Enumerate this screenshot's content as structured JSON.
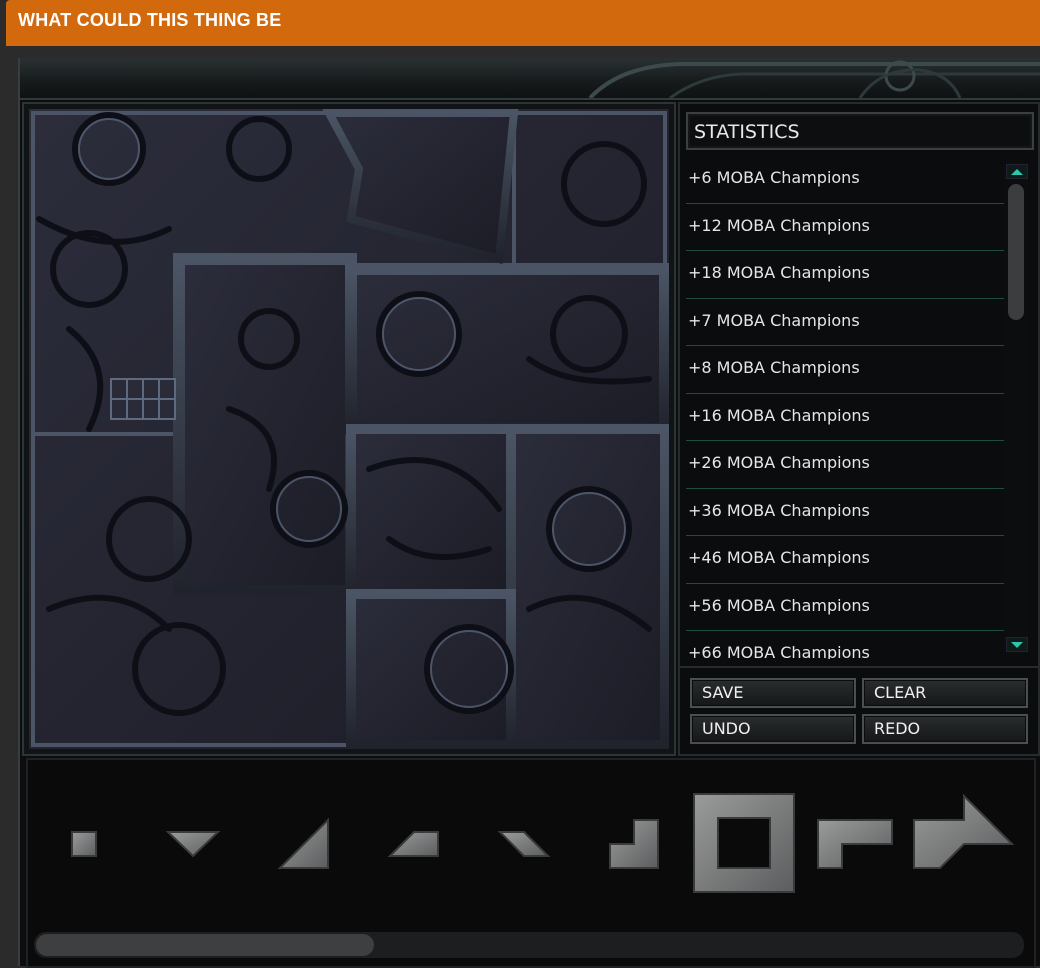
{
  "window": {
    "title": "WHAT COULD THIS THING BE"
  },
  "statistics": {
    "title": "STATISTICS",
    "items": [
      "+6 MOBA Champions",
      "+12 MOBA Champions",
      "+18 MOBA Champions",
      "+7 MOBA Champions",
      "+8 MOBA Champions",
      "+16 MOBA Champions",
      "+26 MOBA Champions",
      "+36 MOBA Champions",
      "+46 MOBA Champions",
      "+56 MOBA Champions",
      "+66 MOBA Champions"
    ]
  },
  "buttons": {
    "save": "SAVE",
    "clear": "CLEAR",
    "undo": "UNDO",
    "redo": "REDO"
  },
  "tray": {
    "pieces": [
      "small-square",
      "small-triangle-down",
      "large-triangle",
      "parallelogram-left",
      "parallelogram-right",
      "step-block",
      "hollow-square",
      "l-block",
      "arrow-block"
    ]
  },
  "colors": {
    "title_bar": "#d2690c",
    "accent": "#2ec5a8",
    "divider": "#1d4d3f"
  }
}
